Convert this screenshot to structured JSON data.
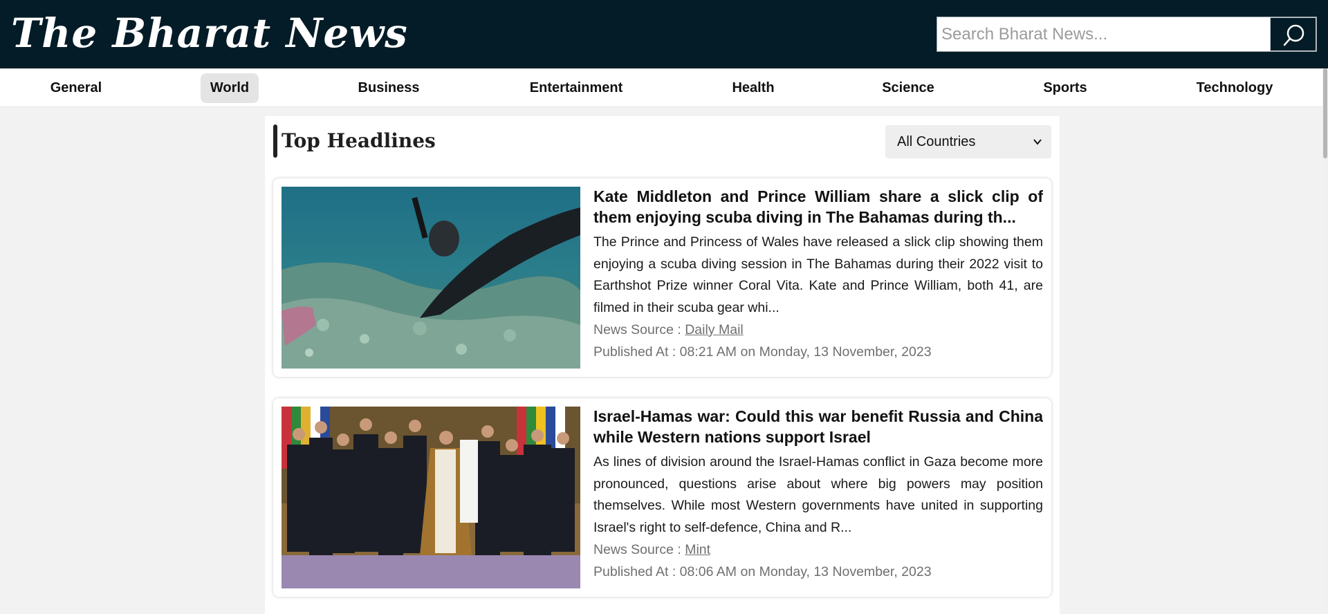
{
  "site": {
    "title": "The Bharat News"
  },
  "search": {
    "placeholder": "Search Bharat News..."
  },
  "nav": {
    "items": [
      {
        "label": "General",
        "active": false
      },
      {
        "label": "World",
        "active": true
      },
      {
        "label": "Business",
        "active": false
      },
      {
        "label": "Entertainment",
        "active": false
      },
      {
        "label": "Health",
        "active": false
      },
      {
        "label": "Science",
        "active": false
      },
      {
        "label": "Sports",
        "active": false
      },
      {
        "label": "Technology",
        "active": false
      }
    ]
  },
  "section": {
    "title": "Top Headlines",
    "country_filter": "All Countries"
  },
  "articles": [
    {
      "title": "Kate Middleton and Prince William share a slick clip of them enjoying scuba diving in The Bahamas during th...",
      "description": "The Prince and Princess of Wales have released a slick clip showing them enjoying a scuba diving session in The Bahamas during their 2022 visit to Earthshot Prize winner Coral Vita. Kate and Prince William, both 41, are filmed in their scuba gear whi...",
      "source_prefix": "News Source : ",
      "source": "Daily Mail",
      "published": "Published At : 08:21 AM on Monday, 13 November, 2023"
    },
    {
      "title": "Israel-Hamas war: Could this war benefit Russia and China while Western nations support Israel",
      "description": "As lines of division around the Israel-Hamas conflict in Gaza become more pronounced, questions arise about where big powers may position themselves. While most Western governments have united in supporting Israel's right to self-defence, China and R...",
      "source_prefix": "News Source : ",
      "source": "Mint",
      "published": "Published At : 08:06 AM on Monday, 13 November, 2023"
    }
  ],
  "colors": {
    "header_bg": "#031c27",
    "page_bg": "#f2f2f2",
    "active_tab_bg": "#e4e4e4",
    "muted_text": "#6f6f6f"
  }
}
